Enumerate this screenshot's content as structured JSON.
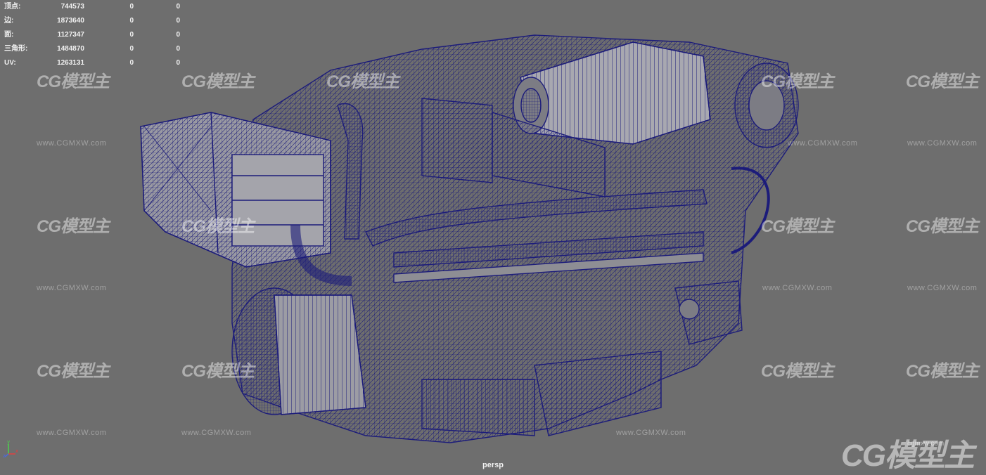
{
  "hud": {
    "rows": [
      {
        "label": "顶点:",
        "v1": "744573",
        "v2": "0",
        "v3": "0"
      },
      {
        "label": "边:",
        "v1": "1873640",
        "v2": "0",
        "v3": "0"
      },
      {
        "label": "面:",
        "v1": "1127347",
        "v2": "0",
        "v3": "0"
      },
      {
        "label": "三角形:",
        "v1": "1484870",
        "v2": "0",
        "v3": "0"
      },
      {
        "label": "UV:",
        "v1": "1263131",
        "v2": "0",
        "v3": "0"
      }
    ]
  },
  "viewport": {
    "camera": "persp",
    "background_color": "#6e6e6e",
    "wireframe_color": "#1c1c7a",
    "axes": {
      "x": "x",
      "y": "y",
      "z": "z"
    }
  },
  "watermark": {
    "logo": "CG模型主",
    "url": "www.CGMXW.com",
    "corner_url": "cgmxw.com"
  }
}
